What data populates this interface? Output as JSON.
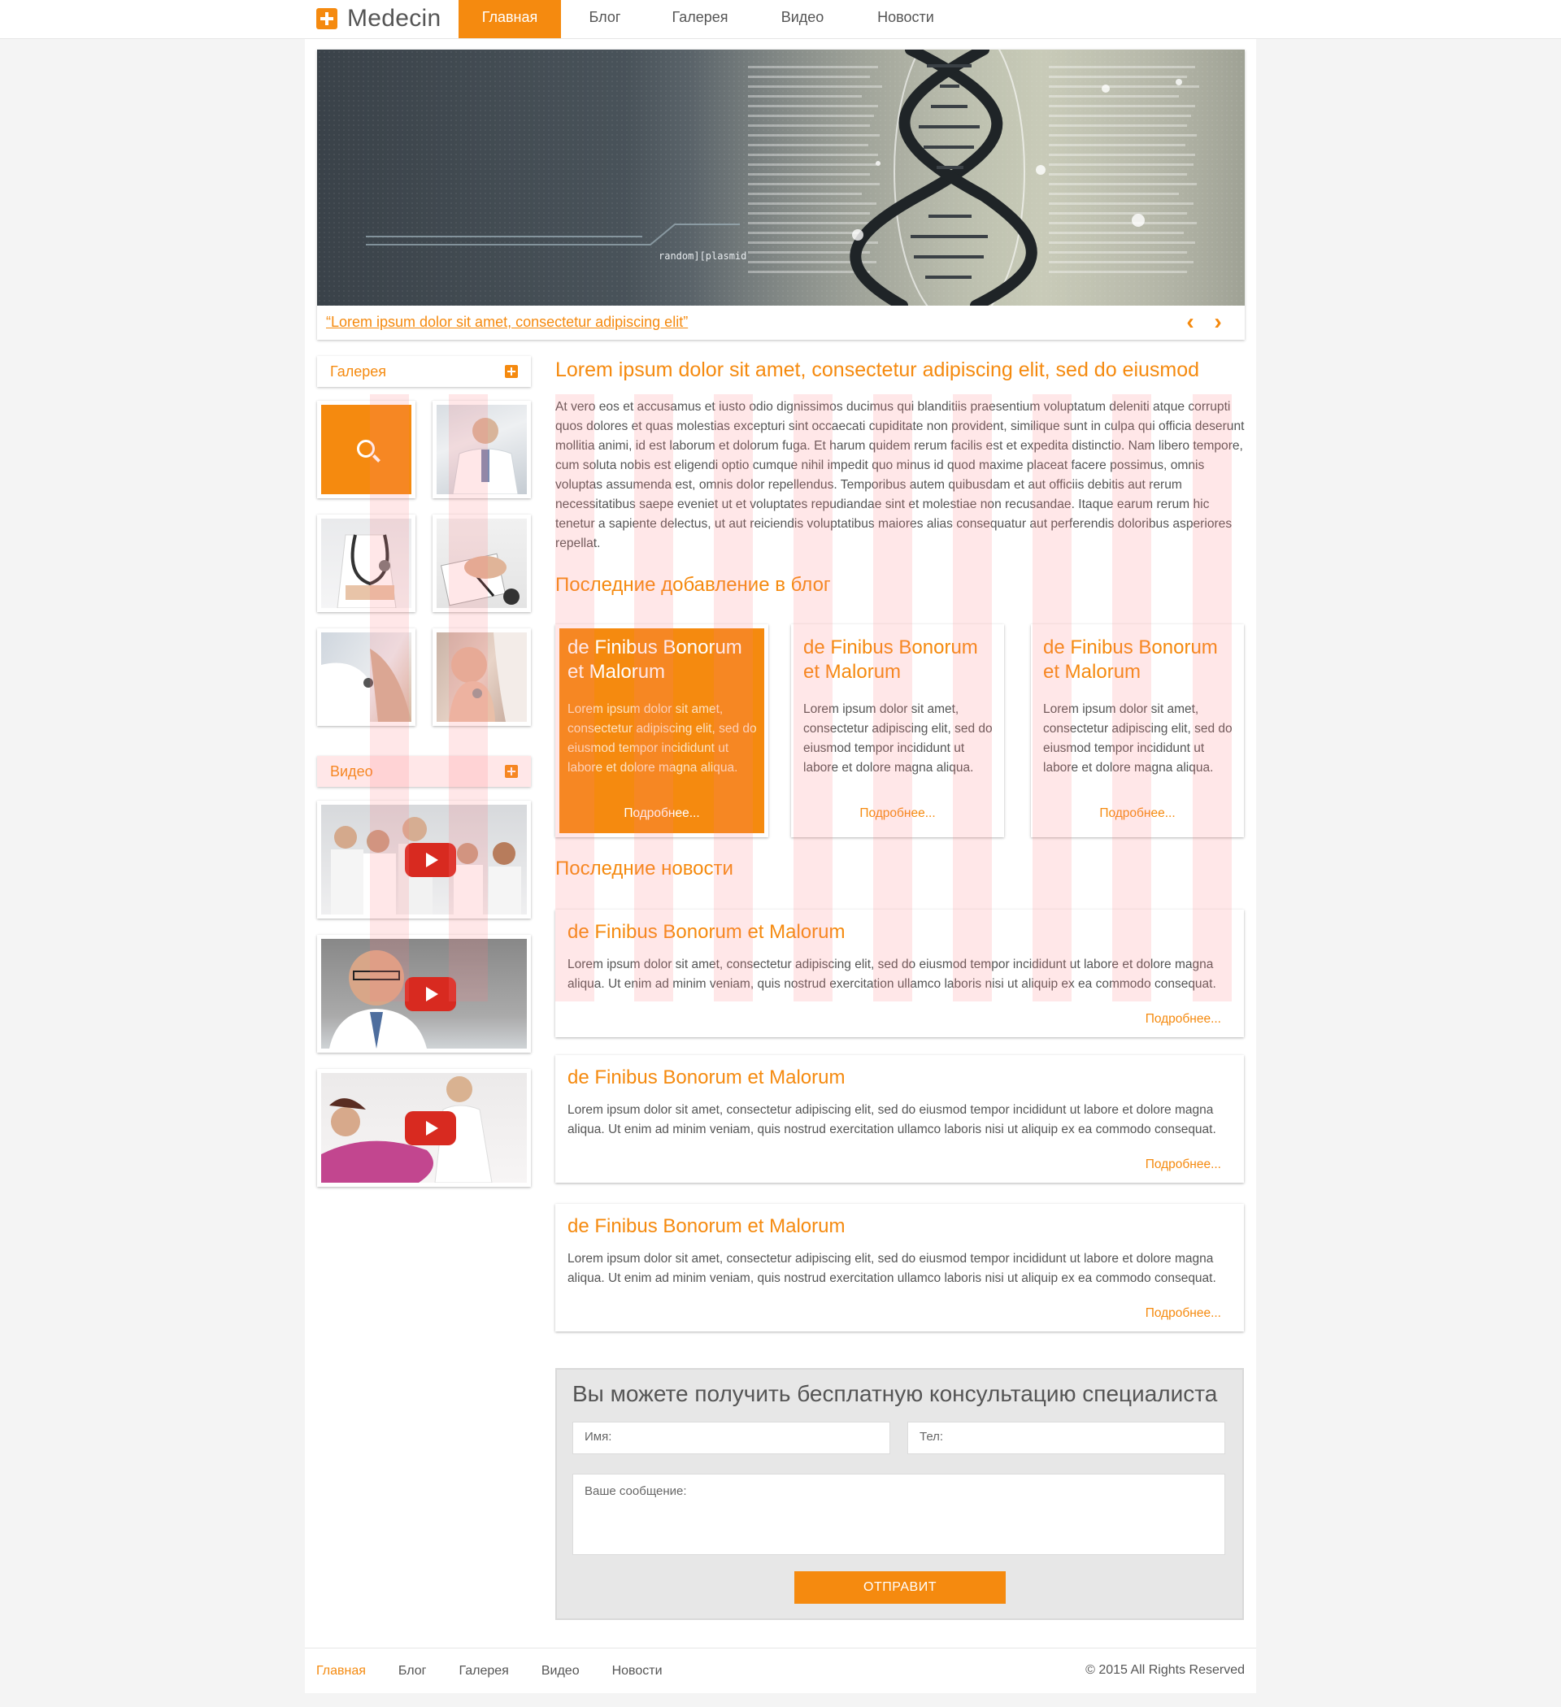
{
  "header": {
    "logo_text": "Medecin",
    "nav": [
      {
        "label": "Главная",
        "active": true
      },
      {
        "label": "Блог"
      },
      {
        "label": "Галерея"
      },
      {
        "label": "Видео"
      },
      {
        "label": "Новости"
      }
    ]
  },
  "slider": {
    "caption": "“Lorem ipsum dolor sit amet, consectetur adipiscing elit”",
    "image_label": "random][plasmid",
    "prev_icon": "chevron-left-icon",
    "next_icon": "chevron-right-icon"
  },
  "sidebar": {
    "gallery_label": "Галерея",
    "video_label": "Видео"
  },
  "main": {
    "title": "Lorem ipsum dolor sit amet, consectetur adipiscing elit, sed do eiusmod",
    "text": "At vero eos et accusamus et iusto odio dignissimos ducimus qui blanditiis praesentium voluptatum deleniti atque corrupti quos dolores et quas molestias excepturi sint occaecati cupiditate non provident, similique sunt in culpa qui officia deserunt mollitia animi, id est laborum et dolorum fuga. Et harum quidem rerum facilis est et expedita distinctio. Nam libero tempore, cum soluta nobis est eligendi optio cumque nihil impedit quo minus id quod maxime placeat facere possimus, omnis voluptas assumenda est, omnis dolor repellendus. Temporibus autem quibusdam et aut officiis debitis aut rerum necessitatibus saepe eveniet ut et voluptates repudiandae sint et molestiae non recusandae. Itaque earum rerum hic tenetur a sapiente delectus, ut aut reiciendis voluptatibus maiores alias consequatur aut perferendis doloribus asperiores repellat.",
    "blog_heading": "Последние добавление в блог",
    "blog_cards": [
      {
        "title": "de Finibus Bonorum et Malorum",
        "text": "Lorem ipsum dolor sit amet, consectetur adipiscing elit, sed do eiusmod tempor incididunt ut labore et dolore magna aliqua.",
        "more": "Подробнее..."
      },
      {
        "title": "de Finibus Bonorum et Malorum",
        "text": "Lorem ipsum dolor sit amet, consectetur adipiscing elit, sed do eiusmod tempor incididunt ut labore et dolore magna aliqua.",
        "more": "Подробнее..."
      },
      {
        "title": "de Finibus Bonorum et Malorum",
        "text": "Lorem ipsum dolor sit amet, consectetur adipiscing elit, sed do eiusmod tempor incididunt ut labore et dolore magna aliqua.",
        "more": "Подробнее..."
      }
    ],
    "news_heading": "Последние новости",
    "news": [
      {
        "title": "de Finibus Bonorum et Malorum",
        "text": "Lorem ipsum dolor sit amet, consectetur adipiscing elit, sed do eiusmod tempor incididunt ut labore et dolore magna aliqua. Ut enim ad minim veniam, quis nostrud exercitation ullamco laboris nisi ut aliquip ex ea commodo consequat.",
        "more": "Подробнее..."
      },
      {
        "title": "de Finibus Bonorum et Malorum",
        "text": "Lorem ipsum dolor sit amet, consectetur adipiscing elit, sed do eiusmod tempor incididunt ut labore et dolore magna aliqua. Ut enim ad minim veniam, quis nostrud exercitation ullamco laboris nisi ut aliquip ex ea commodo consequat.",
        "more": "Подробнее..."
      },
      {
        "title": "de Finibus Bonorum et Malorum",
        "text": "Lorem ipsum dolor sit amet, consectetur adipiscing elit, sed do eiusmod tempor incididunt ut labore et dolore magna aliqua. Ut enim ad minim veniam, quis nostrud exercitation ullamco laboris nisi ut aliquip ex ea commodo consequat.",
        "more": "Подробнее..."
      }
    ]
  },
  "form": {
    "title": "Вы можете получить бесплатную консультацию специалиста",
    "name_placeholder": "Имя:",
    "phone_placeholder": "Тел:",
    "message_placeholder": "Ваше сообщение:",
    "submit_label": "ОТПРАВИТ"
  },
  "footer": {
    "links": [
      "Главная",
      "Блог",
      "Галерея",
      "Видео",
      "Новости"
    ],
    "copyright": "© 2015 All Rights Reserved"
  },
  "colors": {
    "accent": "#f58a0f",
    "text": "#555555",
    "form_bg": "#e7e7e7",
    "youtube_red": "#d82a20"
  }
}
